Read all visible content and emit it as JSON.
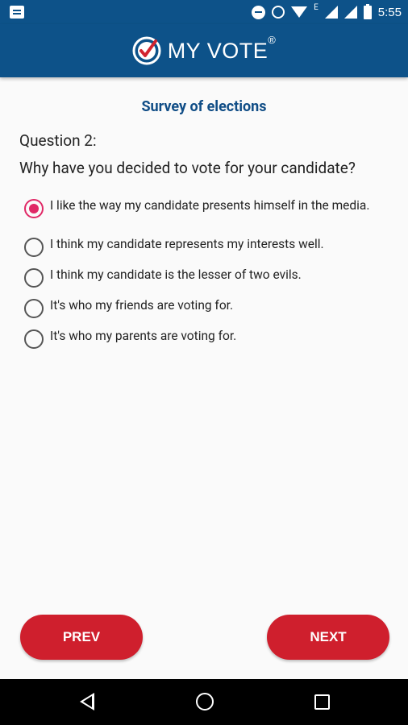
{
  "status_bar": {
    "time": "5:55",
    "network_letter": "E",
    "icons": [
      "notification-icon",
      "do-not-disturb-icon",
      "alarm-icon",
      "wifi-icon",
      "signal-icon",
      "signal-icon",
      "battery-icon"
    ]
  },
  "app_bar": {
    "logo_text": "MY VOTE",
    "logo_reg": "®"
  },
  "survey": {
    "title": "Survey of elections",
    "question_number": "Question 2:",
    "question_text": "Why have you decided to vote for your candidate?",
    "options": [
      {
        "label": "I like the way my candidate presents himself in the media.",
        "selected": true
      },
      {
        "label": "I think my candidate represents my interests well.",
        "selected": false
      },
      {
        "label": "I think my candidate is the lesser of two evils.",
        "selected": false
      },
      {
        "label": "It's who my friends are voting for.",
        "selected": false
      },
      {
        "label": "It's who my parents are voting for.",
        "selected": false
      }
    ]
  },
  "buttons": {
    "prev": "PREV",
    "next": "NEXT"
  },
  "colors": {
    "primary": "#0d5289",
    "title": "#104d86",
    "accent": "#e02866",
    "button": "#cf1f2d"
  }
}
